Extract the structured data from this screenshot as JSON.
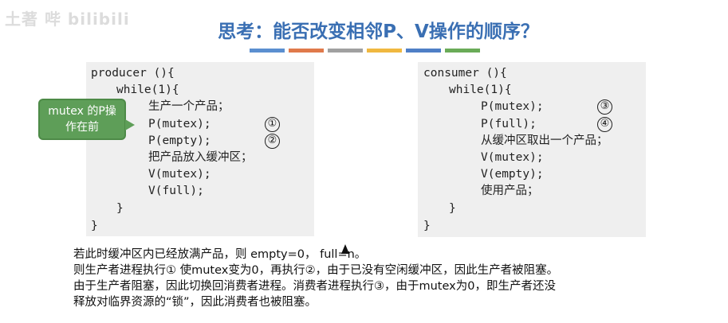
{
  "watermark": "土著 哔 bilibili",
  "title": "思考：能否改变相邻P、V操作的顺序？",
  "color_bar": [
    "#5b8fd0",
    "#e07a4b",
    "#a0a0a0",
    "#f0b840",
    "#4f7fc6",
    "#6aab58"
  ],
  "producer": {
    "lines": [
      "producer (){",
      "while(1){",
      "生产一个产品；",
      "P(mutex);",
      "P(empty);",
      "把产品放入缓冲区；",
      "V(mutex);",
      "V(full);",
      "}",
      "}"
    ],
    "marks": [
      "①",
      "②"
    ]
  },
  "consumer": {
    "lines": [
      "consumer (){",
      "while(1){",
      "P(mutex);",
      "P(full);",
      "从缓冲区取出一个产品；",
      "V(mutex);",
      "V(empty);",
      "使用产品；",
      "}",
      "}"
    ],
    "marks": [
      "③",
      "④"
    ]
  },
  "callout": {
    "line1": "mutex 的P操",
    "line2": "作在前",
    "color": "#5e9e58"
  },
  "explanation": [
    "若此时缓冲区内已经放满产品，则 empty=0， full=n。",
    "则生产者进程执行① 使mutex变为0，再执行②，由于已没有空闲缓冲区，因此生产者被阻塞。",
    "由于生产者阻塞，因此切换回消费者进程。消费者进程执行③，由于mutex为0，即生产者还没",
    "释放对临界资源的“锁”，因此消费者也被阻塞。"
  ]
}
